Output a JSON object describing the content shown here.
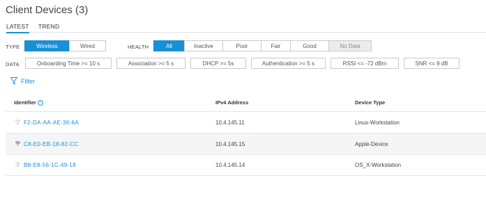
{
  "page": {
    "title": "Client Devices (3)"
  },
  "tabs": [
    {
      "label": "LATEST",
      "active": true
    },
    {
      "label": "TREND",
      "active": false
    }
  ],
  "filters": {
    "type": {
      "label": "TYPE",
      "options": [
        "Wireless",
        "Wired"
      ],
      "selected": "Wireless"
    },
    "health": {
      "label": "HEALTH",
      "options": [
        "All",
        "Inactive",
        "Poor",
        "Fair",
        "Good",
        "No Data"
      ],
      "selected": "All",
      "disabled": [
        "No Data"
      ]
    },
    "data": {
      "label": "DATA",
      "chips": [
        "Onboarding Time >= 10 s",
        "Association >= 5 s",
        "DHCP >= 5s",
        "Authentication >= 5 s",
        "RSSI <= -72 dBm",
        "SNR <= 9 dB"
      ]
    },
    "filter_link": "Filter"
  },
  "table": {
    "columns": [
      "Identifier",
      "IPv4 Address",
      "Device Type"
    ],
    "info_glyph": "i",
    "rows": [
      {
        "identifier": "F2-DA-AA-AE-36-6A",
        "ipv4": "10.4.145.11",
        "device_type": "Linux-Workstation",
        "signal_icon": "wifi-weak-icon"
      },
      {
        "identifier": "C8-E0-EB-18-82-CC",
        "ipv4": "10.4.145.15",
        "device_type": "Apple-Device",
        "signal_icon": "wifi-strong-icon"
      },
      {
        "identifier": "B8-E8-56-1C-49-18",
        "ipv4": "10.4.145.14",
        "device_type": "OS_X-Workstation",
        "signal_icon": "wifi-weak-icon"
      }
    ]
  },
  "colors": {
    "accent": "#1b8fd6",
    "row_alt": "#f4f5f7"
  }
}
